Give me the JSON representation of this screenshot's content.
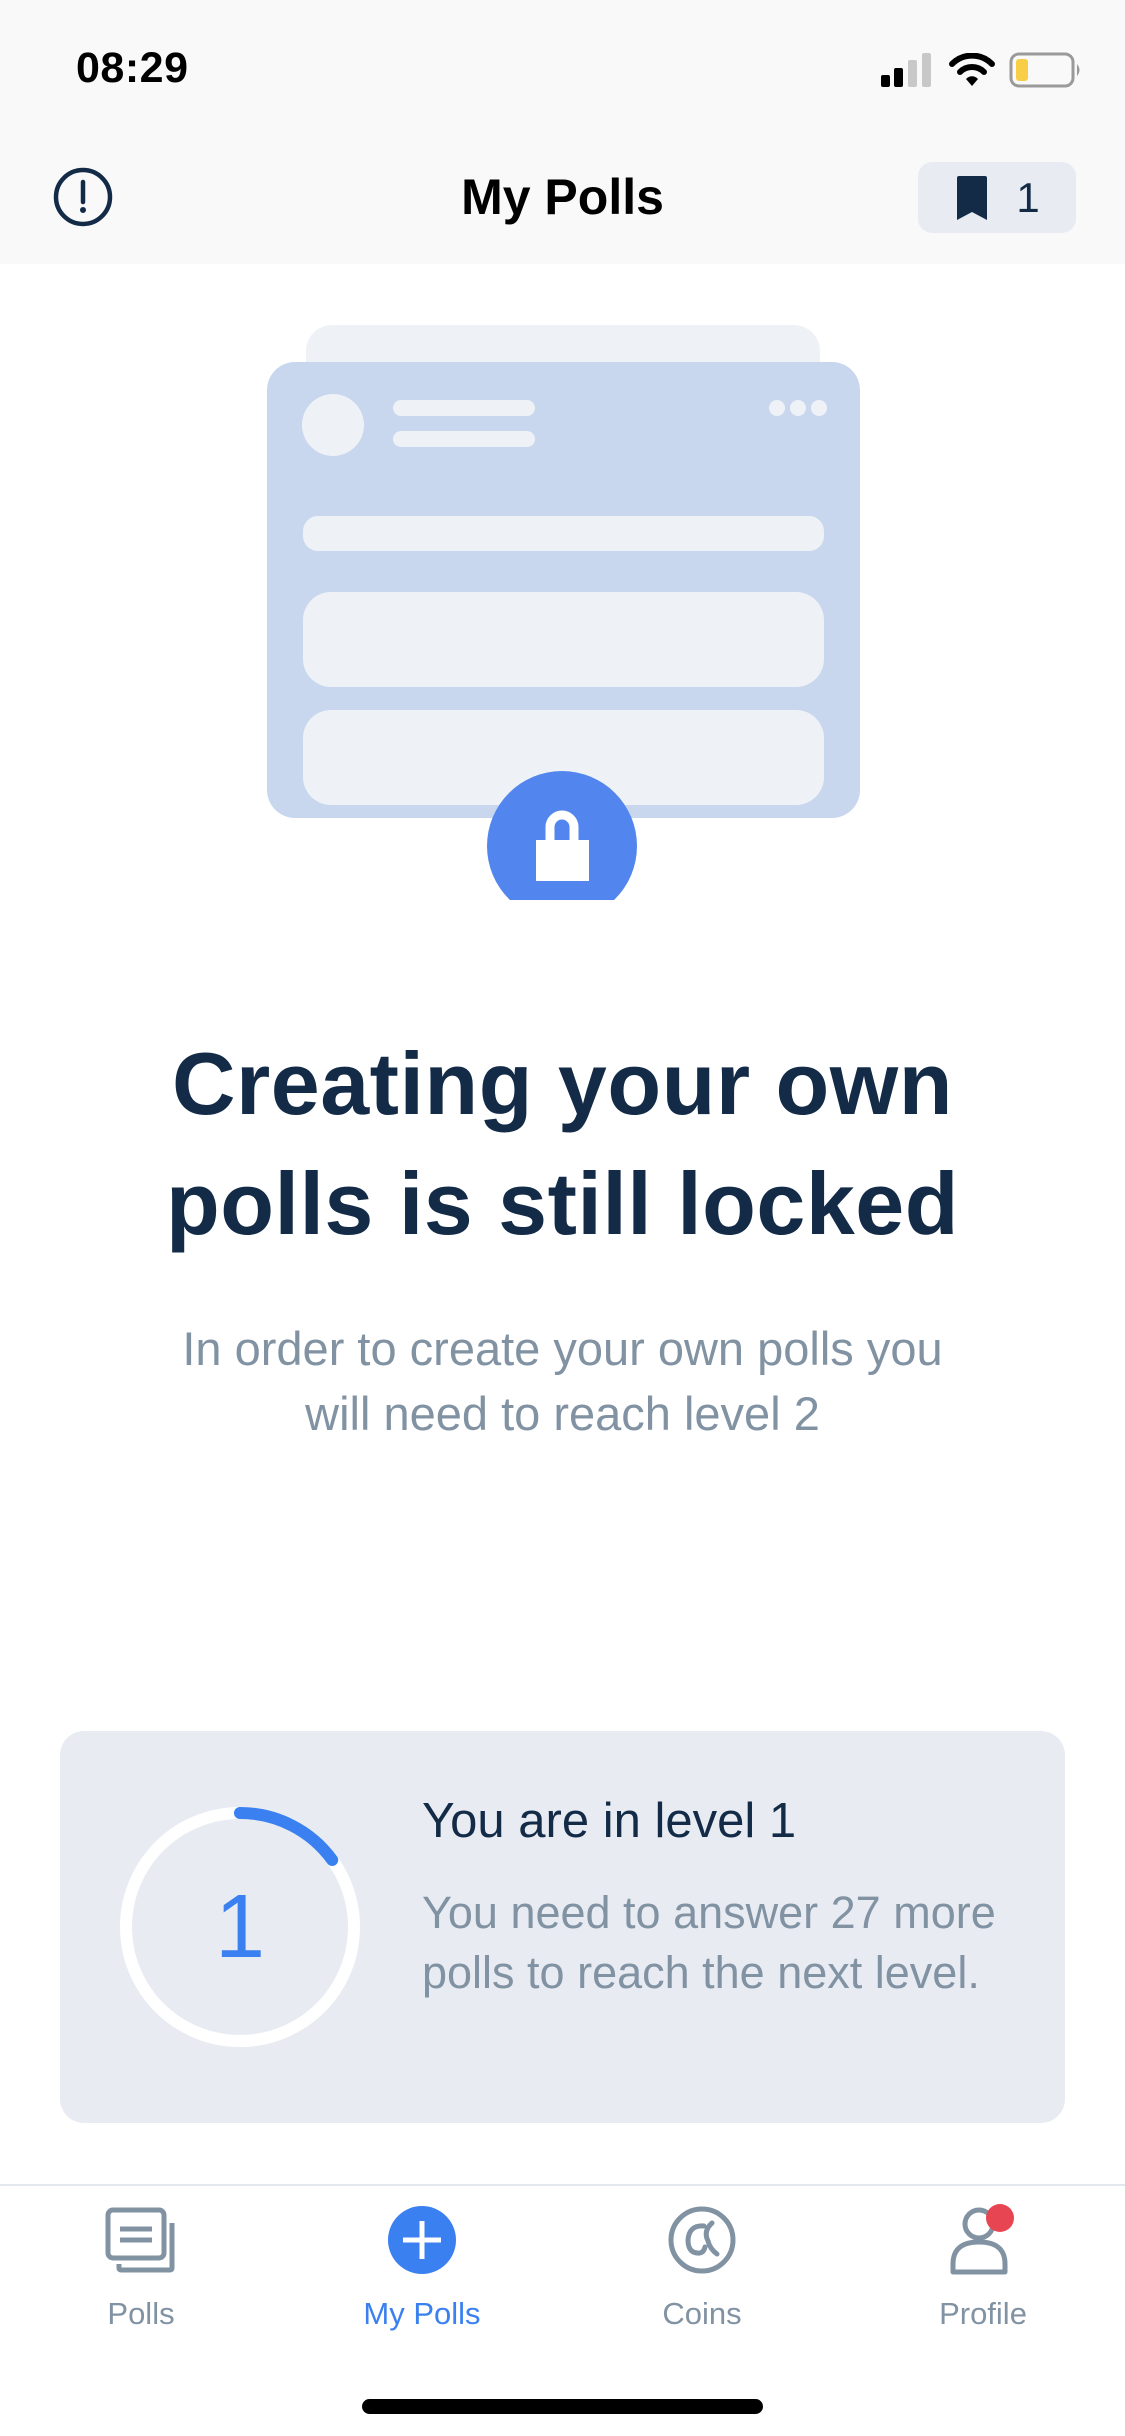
{
  "status_bar": {
    "time": "08:29",
    "signal_bars_active": 2,
    "signal_bars_total": 4,
    "battery_level": 0.2,
    "battery_color": "#F7CE46"
  },
  "header": {
    "title": "My Polls",
    "info_icon": "exclamation-circle-icon",
    "bookmark_icon": "bookmark-icon",
    "bookmark_count": "1"
  },
  "illustration": {
    "description": "locked poll card",
    "lock_icon": "lock-icon",
    "accent_color": "#5286EE"
  },
  "main": {
    "headline_line1": "Creating your own",
    "headline_line2": "polls is still locked",
    "subtitle_line1": "In order to create your own polls you",
    "subtitle_line2": "will need to reach level 2"
  },
  "level_card": {
    "level_number": "1",
    "progress_fraction": 0.15,
    "title": "You are in level 1",
    "description": "You need to answer 27 more polls to reach the next level.",
    "polls_remaining": 27,
    "progress_color": "#3A80F0"
  },
  "tab_bar": {
    "active_tab": "My Polls",
    "tabs": [
      {
        "label": "Polls",
        "icon": "polls-icon"
      },
      {
        "label": "My Polls",
        "icon": "plus-circle-icon"
      },
      {
        "label": "Coins",
        "icon": "coins-icon"
      },
      {
        "label": "Profile",
        "icon": "profile-icon",
        "has_notification_badge": true
      }
    ],
    "badge_color": "#E84553"
  }
}
